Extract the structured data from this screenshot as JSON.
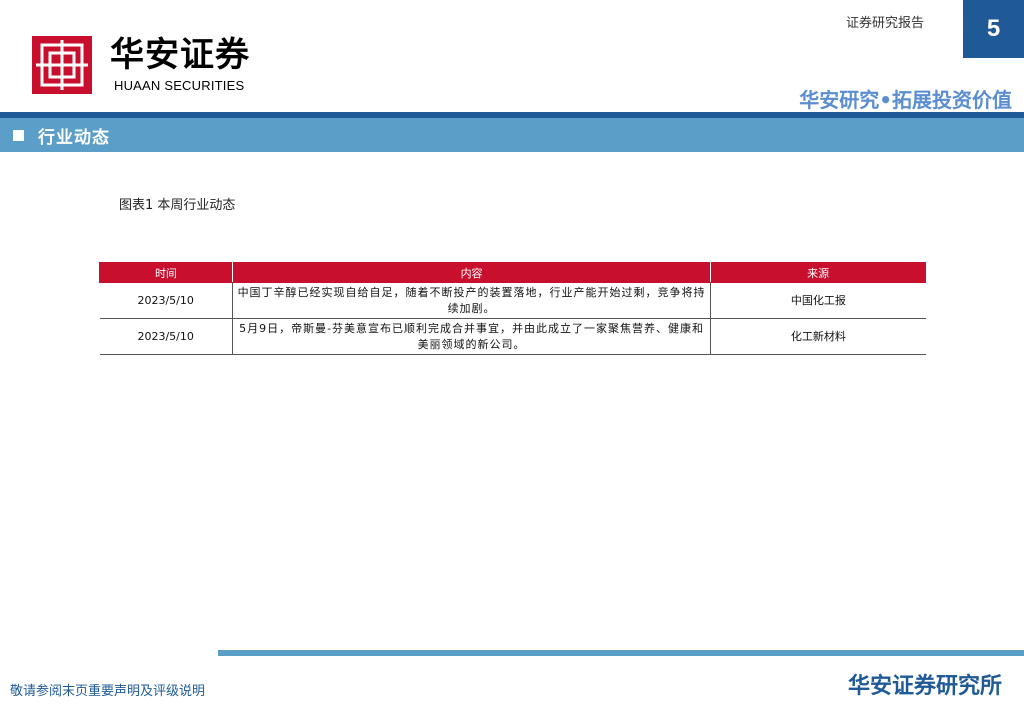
{
  "header": {
    "logo_cn": "华安证券",
    "logo_en": "HUAAN SECURITIES",
    "report_type": "证券研究报告",
    "page_number": "5",
    "slogan": "华安研究•拓展投资价值",
    "colors": {
      "primary": "#1f5a96",
      "accent": "#5b9fc8",
      "logo_red": "#c8102e",
      "slogan": "#5b8ed0"
    }
  },
  "section": {
    "title": "行业动态"
  },
  "figure": {
    "caption": "图表1 本周行业动态"
  },
  "table": {
    "headers": [
      "时间",
      "内容",
      "来源"
    ],
    "rows": [
      {
        "date": "2023/5/10",
        "content": "中国丁辛醇已经实现自给自足，随着不断投产的装置落地，行业产能开始过剩，竞争将持续加剧。",
        "source": "中国化工报"
      },
      {
        "date": "2023/5/10",
        "content": "5月9日，帝斯曼-芬美意宣布已顺利完成合并事宜，并由此成立了一家聚焦营养、健康和美丽领域的新公司。",
        "source": "化工新材料"
      }
    ]
  },
  "footer": {
    "disclaimer": "敬请参阅末页重要声明及评级说明",
    "brand": "华安证券研究所"
  }
}
